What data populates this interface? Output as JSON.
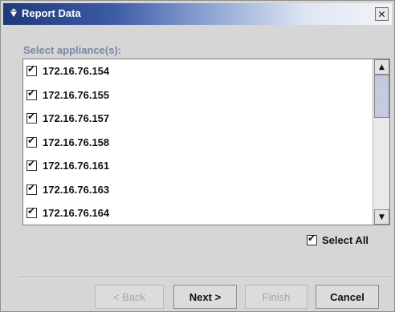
{
  "window": {
    "title": "Report Data",
    "close_glyph": "✕"
  },
  "section": {
    "label": "Select appliance(s):"
  },
  "appliances": [
    {
      "label": "172.16.76.154",
      "checked": true
    },
    {
      "label": "172.16.76.155",
      "checked": true
    },
    {
      "label": "172.16.76.157",
      "checked": true
    },
    {
      "label": "172.16.76.158",
      "checked": true
    },
    {
      "label": "172.16.76.161",
      "checked": true
    },
    {
      "label": "172.16.76.163",
      "checked": true
    },
    {
      "label": "172.16.76.164",
      "checked": true
    }
  ],
  "select_all": {
    "label": "Select All",
    "checked": true
  },
  "buttons": {
    "back": "< Back",
    "next": "Next >",
    "finish": "Finish",
    "cancel": "Cancel"
  },
  "icons": {
    "title": "app-icon",
    "close": "close-icon",
    "scroll_up": "arrow-up-icon",
    "scroll_down": "arrow-down-icon"
  }
}
